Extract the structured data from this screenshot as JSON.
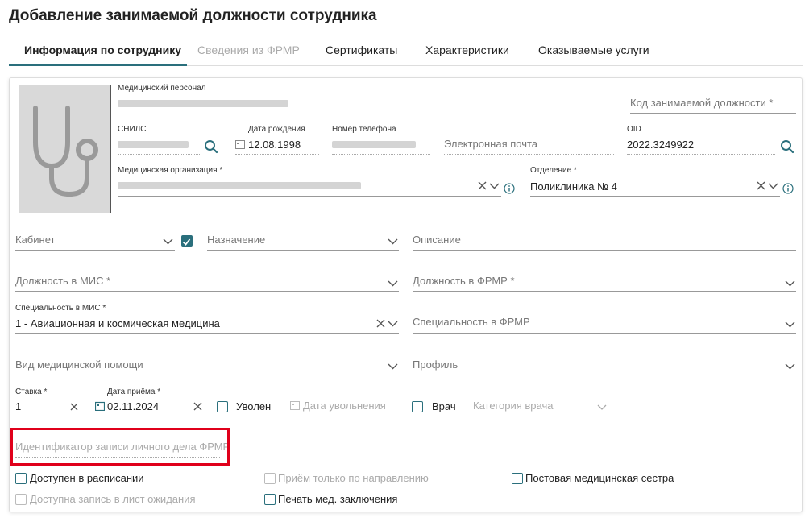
{
  "page": {
    "title": "Добавление занимаемой должности сотрудника"
  },
  "tabs": [
    {
      "label": "Информация по сотруднику",
      "state": "active"
    },
    {
      "label": "Сведения из ФРМР",
      "state": "disabled"
    },
    {
      "label": "Сертификаты",
      "state": "normal"
    },
    {
      "label": "Характеристики",
      "state": "normal"
    },
    {
      "label": "Оказываемые услуги",
      "state": "normal"
    }
  ],
  "employee": {
    "personnel_label": "Медицинский персонал",
    "position_code_placeholder": "Код занимаемой должности *",
    "snils_label": "СНИЛС",
    "birth_label": "Дата рождения",
    "birth_value": "12.08.1998",
    "phone_label": "Номер телефона",
    "email_placeholder": "Электронная почта",
    "oid_label": "OID",
    "oid_value": "2022.3249922",
    "org_label": "Медицинская организация *",
    "dept_label": "Отделение *",
    "dept_value": "Поликлиника № 4"
  },
  "form": {
    "cabinet_placeholder": "Кабинет",
    "purpose_placeholder": "Назначение",
    "description_placeholder": "Описание",
    "mis_position_placeholder": "Должность в МИС *",
    "frmr_position_placeholder": "Должность в ФРМР *",
    "mis_specialty_label": "Специальность в МИС *",
    "mis_specialty_value": "1 - Авиационная и космическая медицина",
    "frmr_specialty_placeholder": "Специальность в ФРМР",
    "care_type_placeholder": "Вид медицинской помощи",
    "profile_placeholder": "Профиль",
    "rate_label": "Ставка *",
    "rate_value": "1",
    "hire_label": "Дата приёма *",
    "hire_value": "02.11.2024",
    "fired_label": "Уволен",
    "dismissal_placeholder": "Дата увольнения",
    "doctor_label": "Врач",
    "category_placeholder": "Категория врача",
    "frmr_record_placeholder": "Идентификатор записи личного дела ФРМР"
  },
  "checkboxes": {
    "schedule": "Доступен в расписании",
    "referral_only": "Приём только по направлению",
    "ward_nurse": "Постовая медицинская сестра",
    "waitlist": "Доступна запись в лист ожидания",
    "print_conclusion": "Печать мед. заключения"
  },
  "colors": {
    "accent": "#2a6f7c",
    "highlight": "#e0001b"
  }
}
